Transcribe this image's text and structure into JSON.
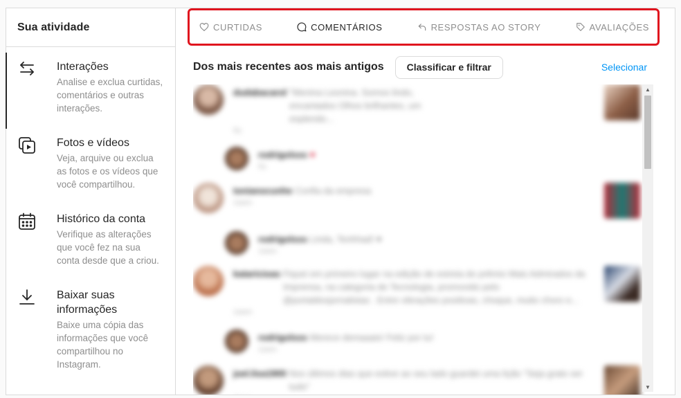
{
  "sidebar": {
    "title": "Sua atividade",
    "items": [
      {
        "label": "Interações",
        "description": "Analise e exclua curtidas, comentários e outras interações.",
        "icon": "arrows-swap-icon"
      },
      {
        "label": "Fotos e vídeos",
        "description": "Veja, arquive ou exclua as fotos e os vídeos que você compartilhou.",
        "icon": "photos-videos-icon"
      },
      {
        "label": "Histórico da conta",
        "description": "Verifique as alterações que você fez na sua conta desde que a criou.",
        "icon": "calendar-icon"
      },
      {
        "label": "Baixar suas informações",
        "description": "Baixe uma cópia das informações que você compartilhou no Instagram.",
        "icon": "download-icon"
      }
    ]
  },
  "tabs": [
    {
      "label": "CURTIDAS",
      "icon": "heart-icon",
      "active": false
    },
    {
      "label": "COMENTÁRIOS",
      "icon": "comment-icon",
      "active": true
    },
    {
      "label": "RESPOSTAS AO STORY",
      "icon": "reply-icon",
      "active": false
    },
    {
      "label": "AVALIAÇÕES",
      "icon": "tag-icon",
      "active": false
    }
  ],
  "toolbar": {
    "sort_title": "Dos mais recentes aos mais antigos",
    "sort_button": "Classificar e filtrar",
    "select_link": "Selecionar"
  },
  "comments": [
    {
      "user": "dudabacarol",
      "text": "\"Menina Leonina. Somos lindo, encantados Olhos brilhantes, um esplendo...",
      "time": "5s",
      "reply": false
    },
    {
      "user": "rodrigolsss",
      "text": "♥",
      "time": "5s",
      "reply": true
    },
    {
      "user": "tonianocunhe",
      "text": "Confia da empresa",
      "time": "1sem",
      "reply": false
    },
    {
      "user": "rodrigolsss",
      "text": "Linda, Tenhhad! ♥",
      "time": "1sem",
      "reply": true
    },
    {
      "user": "kataricioas",
      "text": "Fiquei em primeiro lugar na edição de estreia do prêmio Mais Admirados da Imprensa, na categoria de Tecnologia, promovido pelo @portaldosjornalistas . Entre vibrações positivas, choque, muito choro e...",
      "time": "1sem",
      "reply": false
    },
    {
      "user": "rodrigolsss",
      "text": "Merece demaaais! Feliz por tu!",
      "time": "1sem",
      "reply": true
    },
    {
      "user": "joel.lisa1900",
      "text": "Nos últimos dias que estive ao seu lado guardei uma lição \"Seja grato ser tudo\"",
      "time": "2sem",
      "reply": false
    }
  ],
  "colors": {
    "accent_blue": "#0095f6",
    "highlight_red": "#e0141e",
    "text_primary": "#262626",
    "text_secondary": "#8e8e8e"
  }
}
